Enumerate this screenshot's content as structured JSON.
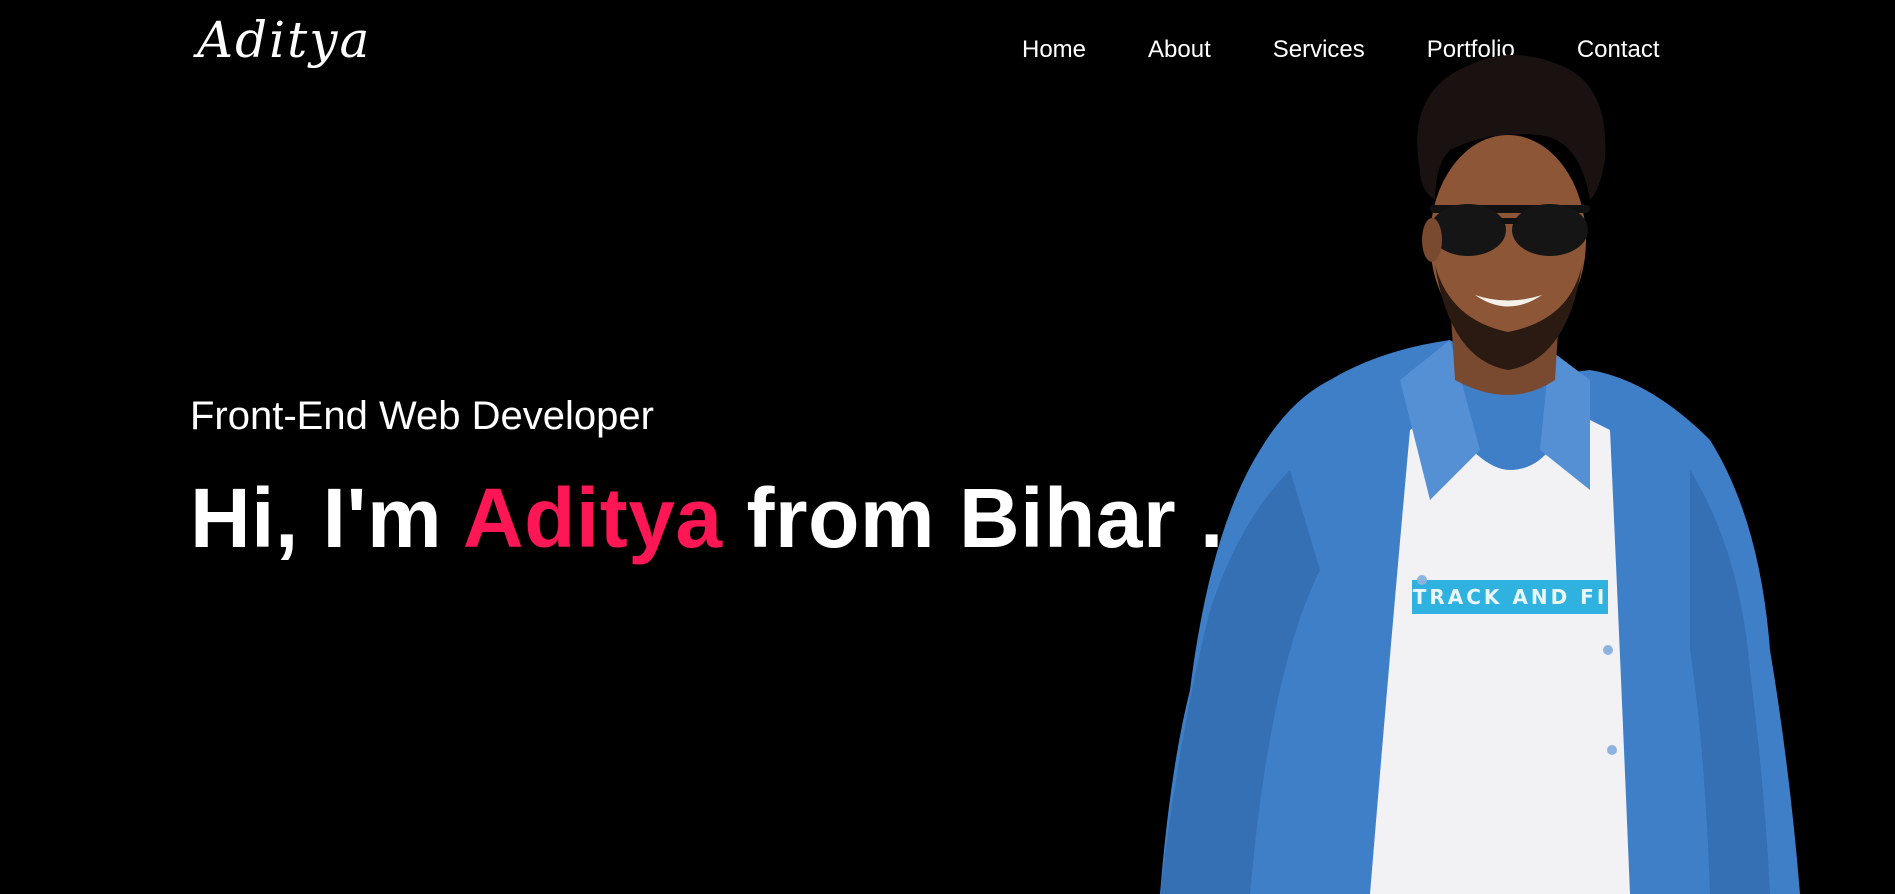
{
  "header": {
    "logo": "Aditya",
    "nav": [
      {
        "label": "Home"
      },
      {
        "label": "About"
      },
      {
        "label": "Services"
      },
      {
        "label": "Portfolio"
      },
      {
        "label": "Contact"
      }
    ]
  },
  "hero": {
    "subtitle": "Front-End Web Developer",
    "title_prefix": "Hi, I'm ",
    "title_name": "Aditya",
    "title_suffix": " from Bihar .",
    "shirt_print": "TRACK AND FI"
  },
  "colors": {
    "background": "#000000",
    "text": "#ffffff",
    "accent": "#ff1654",
    "jacket": "#3f7fc8",
    "shirt": "#f2f2f4",
    "print": "#2fb2df"
  }
}
